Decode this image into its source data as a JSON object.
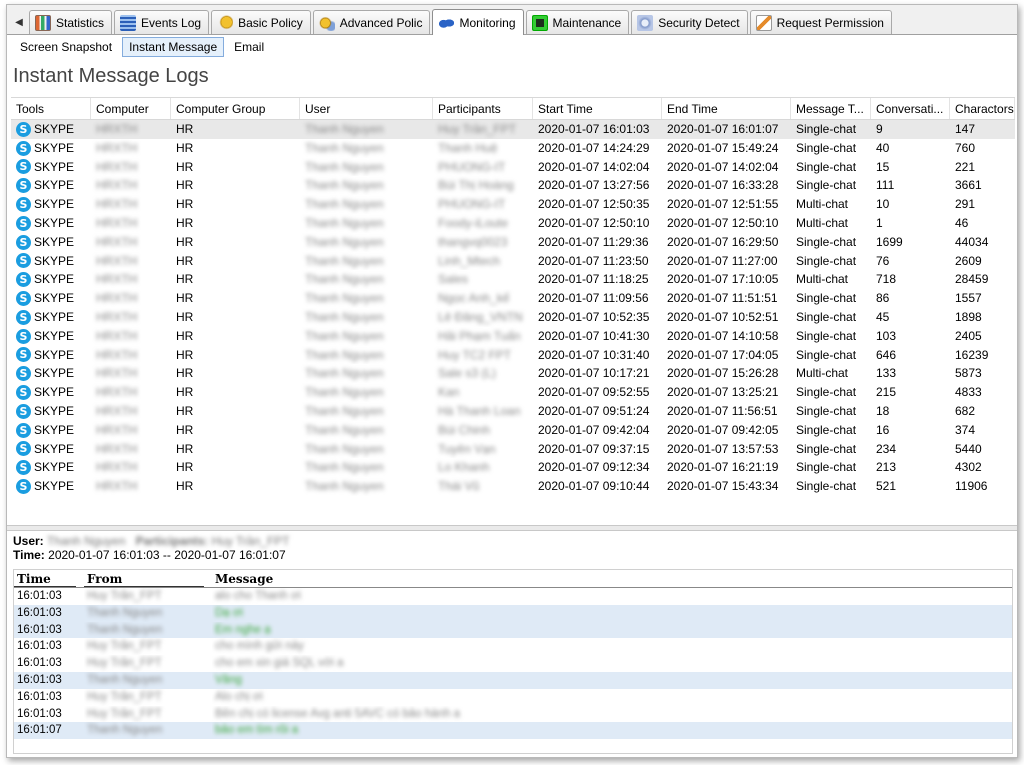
{
  "tabs": [
    {
      "label": "",
      "icon": "scroll-left-icon"
    },
    {
      "label": "Statistics",
      "icon": "statistics-icon"
    },
    {
      "label": "Events Log",
      "icon": "events-log-icon"
    },
    {
      "label": "Basic Policy",
      "icon": "basic-policy-icon"
    },
    {
      "label": "Advanced Polic",
      "icon": "advanced-policy-icon"
    },
    {
      "label": "Monitoring",
      "icon": "monitoring-icon",
      "active": true
    },
    {
      "label": "Maintenance",
      "icon": "maintenance-icon"
    },
    {
      "label": "Security Detect",
      "icon": "security-detect-icon"
    },
    {
      "label": "Request Permission",
      "icon": "request-permission-icon"
    }
  ],
  "subtabs": [
    {
      "label": "Screen Snapshot"
    },
    {
      "label": "Instant Message",
      "active": true
    },
    {
      "label": "Email"
    }
  ],
  "section_title": "Instant Message Logs",
  "columns": [
    "Tools",
    "Computer",
    "Computer Group",
    "User",
    "Participants",
    "Start Time",
    "End Time",
    "Message T...",
    "Conversati...",
    "Charactors"
  ],
  "rows": [
    {
      "tool": "SKYPE",
      "computer": "HRXTH",
      "group": "HR",
      "user": "Thanh Nguyen",
      "participants": "Huy Trần_FPT",
      "start": "2020-01-07 16:01:03",
      "end": "2020-01-07 16:01:07",
      "type": "Single-chat",
      "conv": "9",
      "chars": "147"
    },
    {
      "tool": "SKYPE",
      "computer": "HRXTH",
      "group": "HR",
      "user": "Thanh Nguyen",
      "participants": "Thanh Huệ",
      "start": "2020-01-07 14:24:29",
      "end": "2020-01-07 15:49:24",
      "type": "Single-chat",
      "conv": "40",
      "chars": "760"
    },
    {
      "tool": "SKYPE",
      "computer": "HRXTH",
      "group": "HR",
      "user": "Thanh Nguyen",
      "participants": "PHUONG-IT",
      "start": "2020-01-07 14:02:04",
      "end": "2020-01-07 14:02:04",
      "type": "Single-chat",
      "conv": "15",
      "chars": "221"
    },
    {
      "tool": "SKYPE",
      "computer": "HRXTH",
      "group": "HR",
      "user": "Thanh Nguyen",
      "participants": "Bùi Thị Hoàng",
      "start": "2020-01-07 13:27:56",
      "end": "2020-01-07 16:33:28",
      "type": "Single-chat",
      "conv": "111",
      "chars": "3661"
    },
    {
      "tool": "SKYPE",
      "computer": "HRXTH",
      "group": "HR",
      "user": "Thanh Nguyen",
      "participants": "PHUONG-IT",
      "start": "2020-01-07 12:50:35",
      "end": "2020-01-07 12:51:55",
      "type": "Multi-chat",
      "conv": "10",
      "chars": "291"
    },
    {
      "tool": "SKYPE",
      "computer": "HRXTH",
      "group": "HR",
      "user": "Thanh Nguyen",
      "participants": "Foody-iLoute",
      "start": "2020-01-07 12:50:10",
      "end": "2020-01-07 12:50:10",
      "type": "Multi-chat",
      "conv": "1",
      "chars": "46"
    },
    {
      "tool": "SKYPE",
      "computer": "HRXTH",
      "group": "HR",
      "user": "Thanh Nguyen",
      "participants": "thangvq0023",
      "start": "2020-01-07 11:29:36",
      "end": "2020-01-07 16:29:50",
      "type": "Single-chat",
      "conv": "1699",
      "chars": "44034"
    },
    {
      "tool": "SKYPE",
      "computer": "HRXTH",
      "group": "HR",
      "user": "Thanh Nguyen",
      "participants": "Linh_Mtech",
      "start": "2020-01-07 11:23:50",
      "end": "2020-01-07 11:27:00",
      "type": "Single-chat",
      "conv": "76",
      "chars": "2609"
    },
    {
      "tool": "SKYPE",
      "computer": "HRXTH",
      "group": "HR",
      "user": "Thanh Nguyen",
      "participants": "Sales",
      "start": "2020-01-07 11:18:25",
      "end": "2020-01-07 17:10:05",
      "type": "Multi-chat",
      "conv": "718",
      "chars": "28459"
    },
    {
      "tool": "SKYPE",
      "computer": "HRXTH",
      "group": "HR",
      "user": "Thanh Nguyen",
      "participants": "Ngọc Anh_kế",
      "start": "2020-01-07 11:09:56",
      "end": "2020-01-07 11:51:51",
      "type": "Single-chat",
      "conv": "86",
      "chars": "1557"
    },
    {
      "tool": "SKYPE",
      "computer": "HRXTH",
      "group": "HR",
      "user": "Thanh Nguyen",
      "participants": "Lê Đăng_VNTN",
      "start": "2020-01-07 10:52:35",
      "end": "2020-01-07 10:52:51",
      "type": "Single-chat",
      "conv": "45",
      "chars": "1898"
    },
    {
      "tool": "SKYPE",
      "computer": "HRXTH",
      "group": "HR",
      "user": "Thanh Nguyen",
      "participants": "Hải Phạm Tuấn",
      "start": "2020-01-07 10:41:30",
      "end": "2020-01-07 14:10:58",
      "type": "Single-chat",
      "conv": "103",
      "chars": "2405"
    },
    {
      "tool": "SKYPE",
      "computer": "HRXTH",
      "group": "HR",
      "user": "Thanh Nguyen",
      "participants": "Huy TC2 FPT",
      "start": "2020-01-07 10:31:40",
      "end": "2020-01-07 17:04:05",
      "type": "Single-chat",
      "conv": "646",
      "chars": "16239"
    },
    {
      "tool": "SKYPE",
      "computer": "HRXTH",
      "group": "HR",
      "user": "Thanh Nguyen",
      "participants": "Sale s3 (L)",
      "start": "2020-01-07 10:17:21",
      "end": "2020-01-07 15:26:28",
      "type": "Multi-chat",
      "conv": "133",
      "chars": "5873"
    },
    {
      "tool": "SKYPE",
      "computer": "HRXTH",
      "group": "HR",
      "user": "Thanh Nguyen",
      "participants": "Kan",
      "start": "2020-01-07 09:52:55",
      "end": "2020-01-07 13:25:21",
      "type": "Single-chat",
      "conv": "215",
      "chars": "4833"
    },
    {
      "tool": "SKYPE",
      "computer": "HRXTH",
      "group": "HR",
      "user": "Thanh Nguyen",
      "participants": "Hà Thanh Loan",
      "start": "2020-01-07 09:51:24",
      "end": "2020-01-07 11:56:51",
      "type": "Single-chat",
      "conv": "18",
      "chars": "682"
    },
    {
      "tool": "SKYPE",
      "computer": "HRXTH",
      "group": "HR",
      "user": "Thanh Nguyen",
      "participants": "Bùi Chinh",
      "start": "2020-01-07 09:42:04",
      "end": "2020-01-07 09:42:05",
      "type": "Single-chat",
      "conv": "16",
      "chars": "374"
    },
    {
      "tool": "SKYPE",
      "computer": "HRXTH",
      "group": "HR",
      "user": "Thanh Nguyen",
      "participants": "Tuyên Vạn",
      "start": "2020-01-07 09:37:15",
      "end": "2020-01-07 13:57:53",
      "type": "Single-chat",
      "conv": "234",
      "chars": "5440"
    },
    {
      "tool": "SKYPE",
      "computer": "HRXTH",
      "group": "HR",
      "user": "Thanh Nguyen",
      "participants": "Lo Khanh",
      "start": "2020-01-07 09:12:34",
      "end": "2020-01-07 16:21:19",
      "type": "Single-chat",
      "conv": "213",
      "chars": "4302"
    },
    {
      "tool": "SKYPE",
      "computer": "HRXTH",
      "group": "HR",
      "user": "Thanh Nguyen",
      "participants": "Thái Vũ",
      "start": "2020-01-07 09:10:44",
      "end": "2020-01-07 15:43:34",
      "type": "Single-chat",
      "conv": "521",
      "chars": "11906"
    }
  ],
  "detail": {
    "user_label": "User:",
    "user_value": "Thanh Nguyen",
    "participants_label": "Participants:",
    "participants_value": "Huy Trần_FPT",
    "time_label": "Time:",
    "time_value": "2020-01-07 16:01:03 -- 2020-01-07 16:01:07"
  },
  "message_columns": [
    "Time",
    "From",
    "Message"
  ],
  "messages": [
    {
      "time": "16:01:03",
      "from": "Huy Trần_FPT",
      "text": "alo cho Thanh ơi",
      "mine": false
    },
    {
      "time": "16:01:03",
      "from": "Thanh Nguyen",
      "text": "Dạ ơi",
      "mine": true
    },
    {
      "time": "16:01:03",
      "from": "Thanh Nguyen",
      "text": "Em nghe ạ",
      "mine": true
    },
    {
      "time": "16:01:03",
      "from": "Huy Trần_FPT",
      "text": "cho mình gửi này",
      "mine": false
    },
    {
      "time": "16:01:03",
      "from": "Huy Trần_FPT",
      "text": "cho em xin giá SQL với a",
      "mine": false
    },
    {
      "time": "16:01:03",
      "from": "Thanh Nguyen",
      "text": "Vâng",
      "mine": true
    },
    {
      "time": "16:01:03",
      "from": "Huy Trần_FPT",
      "text": "Alo chị ơi",
      "mine": false
    },
    {
      "time": "16:01:03",
      "from": "Huy Trần_FPT",
      "text": "Bên chị có license Avg anti 5AVC có bảo hành a",
      "mine": false
    },
    {
      "time": "16:01:07",
      "from": "Thanh Nguyen",
      "text": "bảo em tìm rồi a",
      "mine": true
    }
  ]
}
